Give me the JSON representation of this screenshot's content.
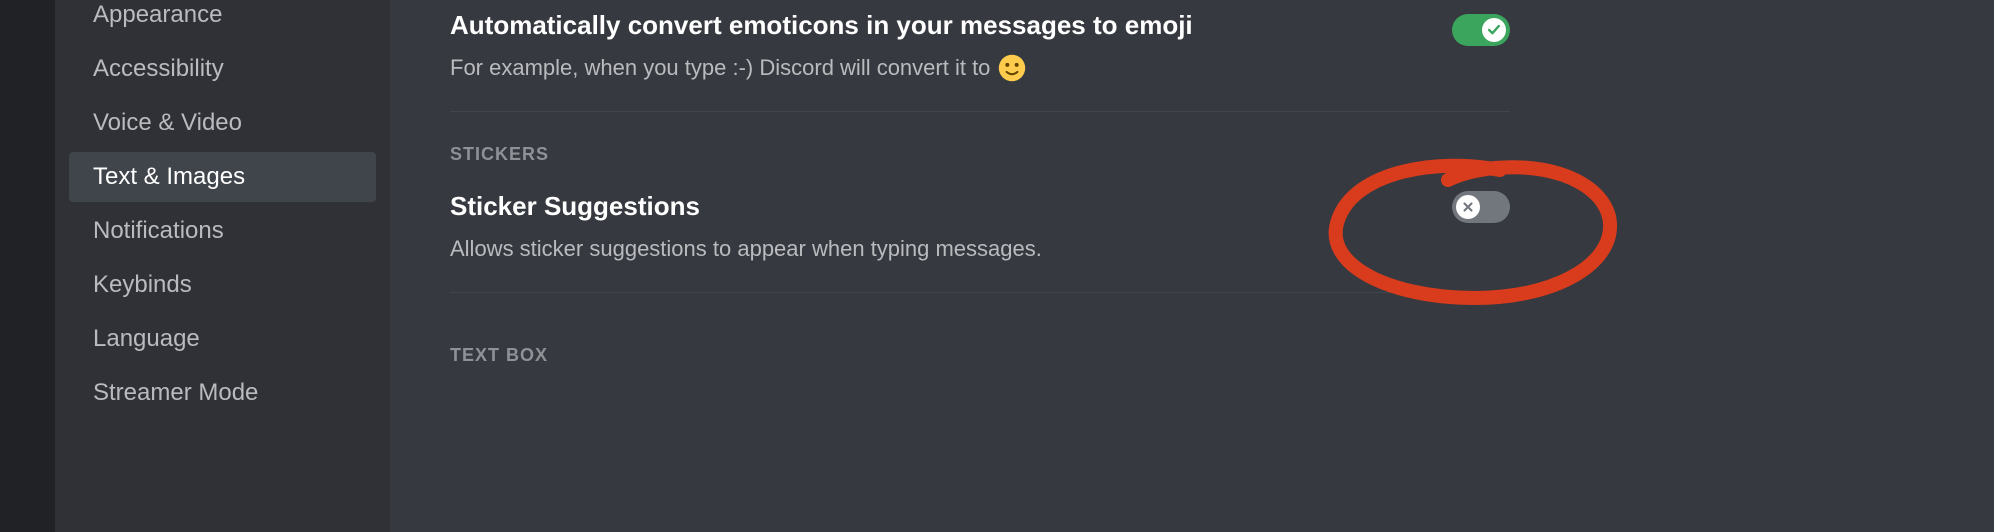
{
  "sidebar": {
    "items": [
      {
        "label": "Appearance",
        "active": false
      },
      {
        "label": "Accessibility",
        "active": false
      },
      {
        "label": "Voice & Video",
        "active": false
      },
      {
        "label": "Text & Images",
        "active": true
      },
      {
        "label": "Notifications",
        "active": false
      },
      {
        "label": "Keybinds",
        "active": false
      },
      {
        "label": "Language",
        "active": false
      },
      {
        "label": "Streamer Mode",
        "active": false
      }
    ]
  },
  "main": {
    "emoticon": {
      "title": "Automatically convert emoticons in your messages to emoji",
      "desc_prefix": "For example, when you type :-) Discord will convert it to",
      "emoji_alt": "slightly-smiling-face",
      "toggle": true
    },
    "stickers_header": "STICKERS",
    "sticker_suggestions": {
      "title": "Sticker Suggestions",
      "desc": "Allows sticker suggestions to appear when typing messages.",
      "toggle": false
    },
    "textbox_header": "TEXT BOX"
  }
}
